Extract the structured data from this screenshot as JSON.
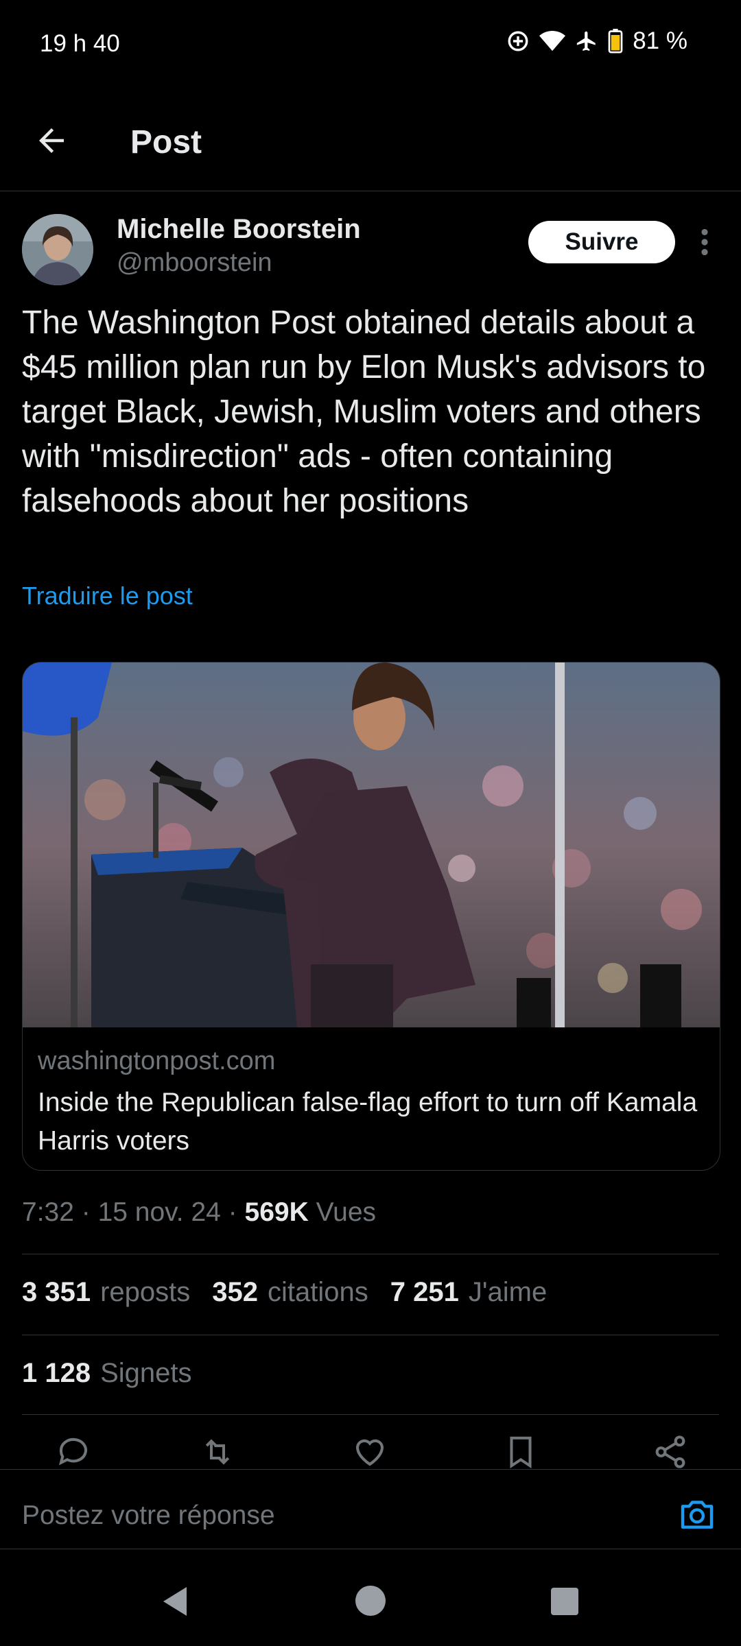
{
  "status_bar": {
    "time": "19 h 40",
    "battery": "81 %"
  },
  "header": {
    "title": "Post"
  },
  "author": {
    "name": "Michelle Boorstein",
    "handle": "@mboorstein",
    "follow_label": "Suivre"
  },
  "post": {
    "text": "The Washington Post obtained details about a $45 million plan run by Elon Musk's advisors to target Black, Jewish, Muslim voters and others with \"misdirection\" ads - often containing falsehoods about her positions",
    "translate_label": "Traduire le post"
  },
  "link_card": {
    "domain": "washingtonpost.com",
    "title": "Inside the Republican false-flag effort to turn off Kamala Harris voters"
  },
  "meta": {
    "time": "7:32",
    "sep1": " · ",
    "date": "15 nov. 24",
    "sep2": " · ",
    "views_count": "569K",
    "views_label": "Vues"
  },
  "stats": [
    {
      "count": "3 351",
      "label": "reposts"
    },
    {
      "count": "352",
      "label": "citations"
    },
    {
      "count": "7 251",
      "label": "J'aime"
    }
  ],
  "bookmarks": {
    "count": "1 128",
    "label": "Signets"
  },
  "reply": {
    "placeholder": "Postez votre réponse"
  },
  "colors": {
    "accent": "#1d9bf0",
    "background": "#000000",
    "text": "#e7e9ea",
    "muted": "#71767b",
    "divider": "#2f3336"
  },
  "icons": [
    "back-arrow-icon",
    "more-icon",
    "reply-icon",
    "repost-icon",
    "like-icon",
    "bookmark-icon",
    "share-icon",
    "camera-icon",
    "nav-back-icon",
    "nav-home-icon",
    "nav-recents-icon"
  ]
}
